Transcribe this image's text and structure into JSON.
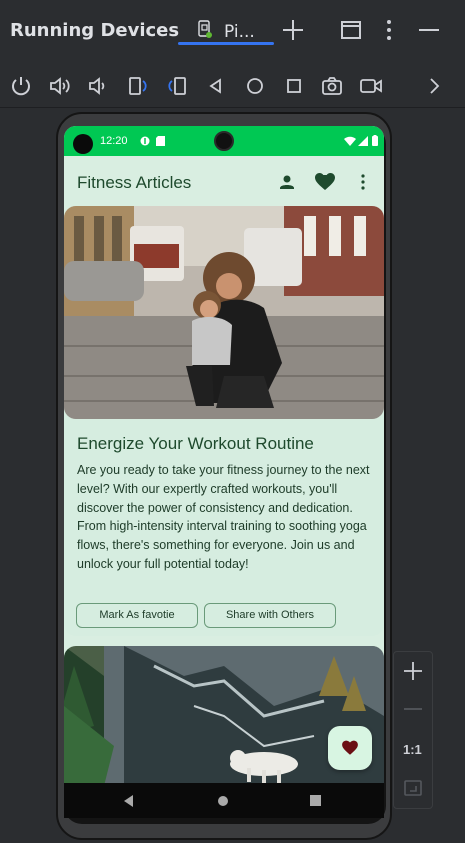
{
  "ide": {
    "window_title": "Running Devices",
    "tab_label": "Pi...",
    "toolbar_icons": [
      "power-icon",
      "volume-up-icon",
      "volume-down-icon",
      "rotate-left-icon",
      "rotate-right-icon",
      "back-icon",
      "home-icon",
      "overview-icon",
      "screenshot-icon",
      "screen-record-icon",
      "more-chevron-icon"
    ],
    "side_zoom_label": "1:1"
  },
  "device": {
    "status_time": "12:20",
    "app_bar": {
      "title": "Fitness Articles"
    },
    "article": {
      "title": "Energize Your Workout Routine",
      "body": "Are you ready to take your fitness journey to the next level? With our expertly crafted workouts, you'll discover the power of consistency and dedication. From high-intensity interval training to soothing yoga flows, there's something for everyone. Join us and unlock your full potential today!",
      "favorite_button": "Mark As favotie",
      "share_button": "Share with Others"
    }
  },
  "colors": {
    "status_bar": "#00c853",
    "app_background": "#d9eee1",
    "accent_dark": "#1e4a2d",
    "fab_heart": "#6b0f14"
  }
}
